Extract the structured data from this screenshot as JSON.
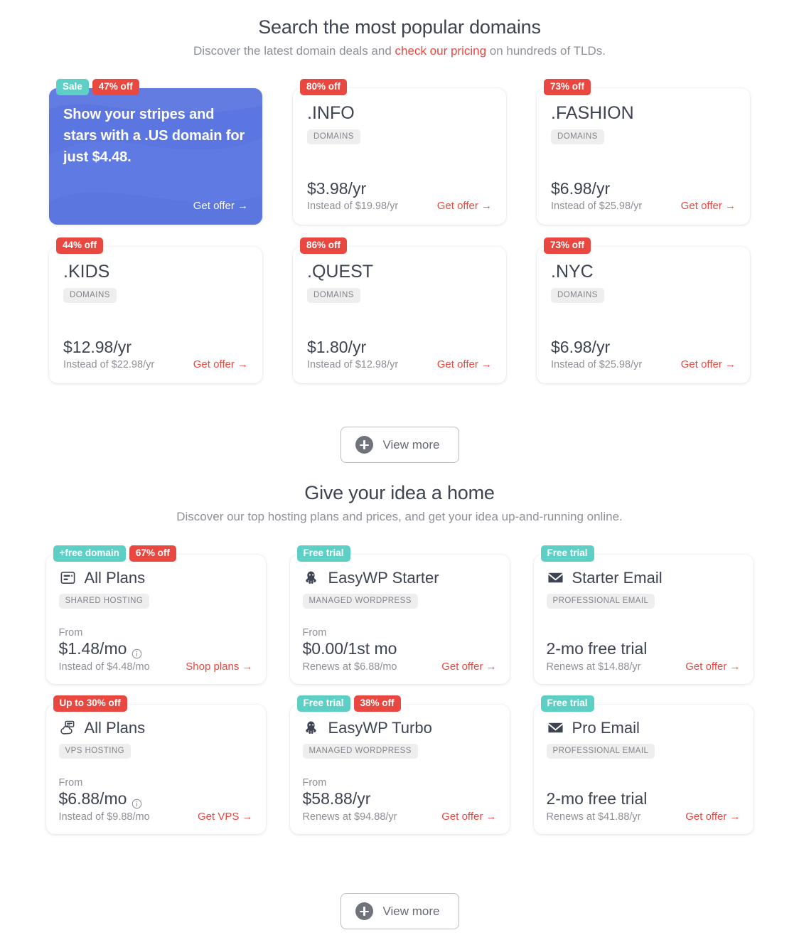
{
  "domains_section": {
    "title": "Search the most popular domains",
    "subtitle_before": "Discover the latest domain deals and ",
    "subtitle_link": "check our pricing",
    "subtitle_after": " on hundreds of TLDs.",
    "view_more_label": "View more",
    "promo": {
      "badges": [
        {
          "text": "Sale",
          "color": "teal"
        },
        {
          "text": "47% off",
          "color": "red"
        }
      ],
      "text": "Show your stripes and stars with a .US domain for just $4.48.",
      "cta": "Get offer →",
      "background_color": "#5b76e0"
    },
    "cards": [
      {
        "badge": "80% off",
        "tld": ".INFO",
        "tag": "DOMAINS",
        "price": "$3.98/yr",
        "instead": "Instead of $19.98/yr",
        "cta": "Get offer →"
      },
      {
        "badge": "73% off",
        "tld": ".FASHION",
        "tag": "DOMAINS",
        "price": "$6.98/yr",
        "instead": "Instead of $25.98/yr",
        "cta": "Get offer →"
      },
      {
        "badge": "44% off",
        "tld": ".KIDS",
        "tag": "DOMAINS",
        "price": "$12.98/yr",
        "instead": "Instead of $22.98/yr",
        "cta": "Get offer →"
      },
      {
        "badge": "86% off",
        "tld": ".QUEST",
        "tag": "DOMAINS",
        "price": "$1.80/yr",
        "instead": "Instead of $12.98/yr",
        "cta": "Get offer →"
      },
      {
        "badge": "73% off",
        "tld": ".NYC",
        "tag": "DOMAINS",
        "price": "$6.98/yr",
        "instead": "Instead of $25.98/yr",
        "cta": "Get offer →"
      }
    ]
  },
  "hosting_section": {
    "title": "Give your idea a home",
    "subtitle": "Discover our top hosting plans and prices, and get your idea up-and-running online.",
    "view_more_label": "View more",
    "cards": [
      {
        "badges": [
          {
            "text": "+free domain",
            "color": "teal"
          },
          {
            "text": "67% off",
            "color": "red"
          }
        ],
        "icon": "webpage-icon",
        "name": "All Plans",
        "tag": "SHARED HOSTING",
        "from_label": "From",
        "price": "$1.48/mo",
        "has_info": true,
        "sub": "Instead of $4.48/mo",
        "cta": "Shop plans →"
      },
      {
        "badges": [
          {
            "text": "Free trial",
            "color": "teal"
          }
        ],
        "icon": "octopus-icon",
        "name": "EasyWP Starter",
        "tag": "MANAGED WORDPRESS",
        "from_label": "From",
        "price": "$0.00/1st mo",
        "has_info": false,
        "sub": "Renews at $6.88/mo",
        "cta": "Get offer →"
      },
      {
        "badges": [
          {
            "text": "Free trial",
            "color": "teal"
          }
        ],
        "icon": "envelope-icon",
        "name": "Starter Email",
        "tag": "PROFESSIONAL EMAIL",
        "from_label": "",
        "price": "2-mo free trial",
        "has_info": false,
        "sub": "Renews at $14.88/yr",
        "cta": "Get offer →"
      },
      {
        "badges": [
          {
            "text": "Up to 30% off",
            "color": "red"
          }
        ],
        "icon": "cloud-server-icon",
        "name": "All Plans",
        "tag": "VPS HOSTING",
        "from_label": "From",
        "price": "$6.88/mo",
        "has_info": true,
        "sub": "Instead of $9.88/mo",
        "cta": "Get VPS →"
      },
      {
        "badges": [
          {
            "text": "Free trial",
            "color": "teal"
          },
          {
            "text": "38% off",
            "color": "red"
          }
        ],
        "icon": "octopus-icon",
        "name": "EasyWP Turbo",
        "tag": "MANAGED WORDPRESS",
        "from_label": "From",
        "price": "$58.88/yr",
        "has_info": false,
        "sub": "Renews at $94.88/yr",
        "cta": "Get offer →"
      },
      {
        "badges": [
          {
            "text": "Free trial",
            "color": "teal"
          }
        ],
        "icon": "envelope-icon",
        "name": "Pro Email",
        "tag": "PROFESSIONAL EMAIL",
        "from_label": "",
        "price": "2-mo free trial",
        "has_info": false,
        "sub": "Renews at $41.88/yr",
        "cta": "Get offer →"
      }
    ]
  },
  "colors": {
    "accent_red": "#e8483f",
    "accent_teal": "#5ecfc4",
    "promo_blue": "#5b76e0",
    "text_dark": "#3d4350",
    "text_muted": "#8d9096"
  }
}
